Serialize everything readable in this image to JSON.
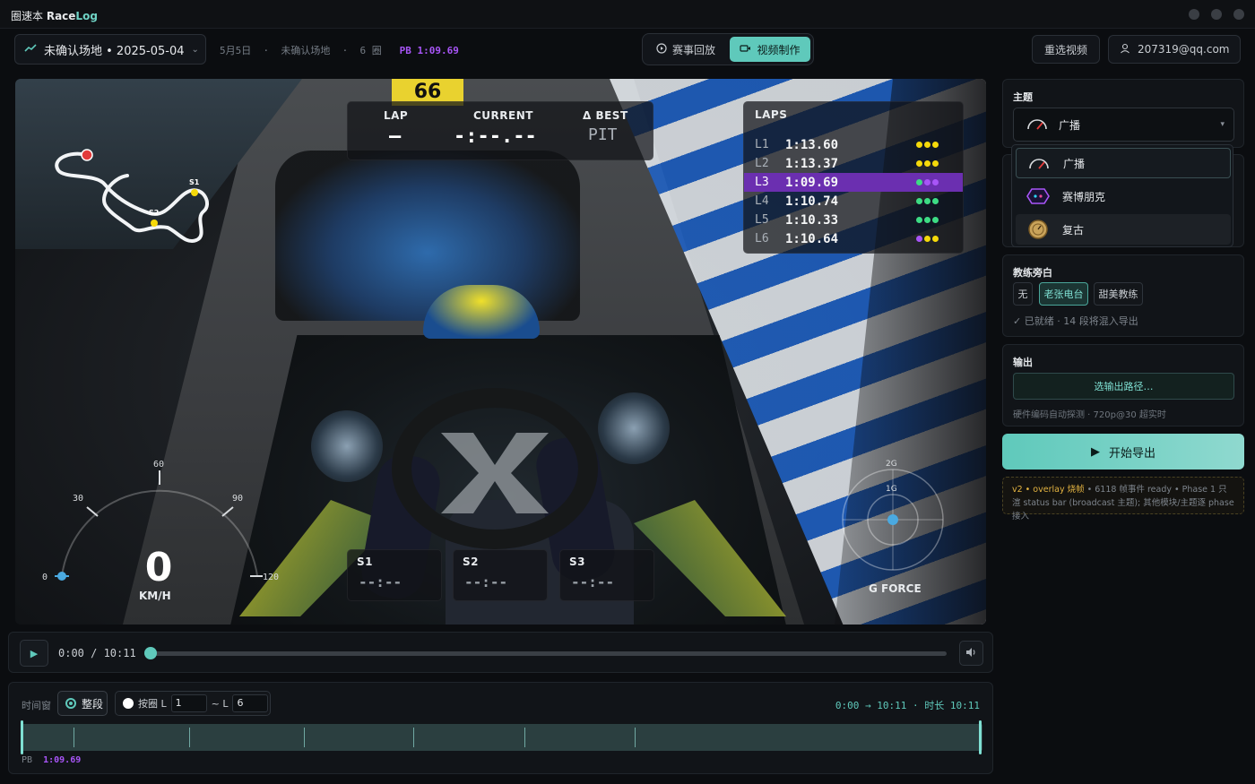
{
  "app": {
    "title_prefix": "圈速本 ",
    "title_brand": "Race",
    "title_brand_accent": "Log"
  },
  "topbar": {
    "session_label": "未确认场地 • 2025-05-04",
    "meta_date": "5月5日",
    "meta_sep": "·",
    "meta_track": "未确认场地",
    "meta_laps": "6 圈",
    "meta_pb_label": "PB",
    "meta_pb_value": "1:09.69",
    "mode_replay": "赛事回放",
    "mode_video": "视频制作",
    "reselect": "重选视频",
    "account": "207319@qq.com"
  },
  "video": {
    "kart_number": "66",
    "lap_label": "LAP",
    "lap_value": "—",
    "current_label": "CURRENT",
    "current_value": "-:--.--",
    "best_label": "Δ BEST",
    "best_value": "PIT",
    "laps_title": "LAPS",
    "laps": [
      {
        "n": "L1",
        "t": "1:13.60",
        "best": false,
        "dots": [
          "#f5d90a",
          "#f5d90a",
          "#f5d90a"
        ]
      },
      {
        "n": "L2",
        "t": "1:13.37",
        "best": false,
        "dots": [
          "#f5d90a",
          "#f5d90a",
          "#f5d90a"
        ]
      },
      {
        "n": "L3",
        "t": "1:09.69",
        "best": true,
        "dots": [
          "#3ddc84",
          "#a855f7",
          "#a855f7"
        ]
      },
      {
        "n": "L4",
        "t": "1:10.74",
        "best": false,
        "dots": [
          "#3ddc84",
          "#3ddc84",
          "#3ddc84"
        ]
      },
      {
        "n": "L5",
        "t": "1:10.33",
        "best": false,
        "dots": [
          "#3ddc84",
          "#3ddc84",
          "#3ddc84"
        ]
      },
      {
        "n": "L6",
        "t": "1:10.64",
        "best": false,
        "dots": [
          "#a855f7",
          "#f5d90a",
          "#f5d90a"
        ]
      }
    ],
    "map_s1": "S1",
    "map_s2": "S2",
    "sectors": [
      {
        "label": "S1",
        "value": "--:--"
      },
      {
        "label": "S2",
        "value": "--:--"
      },
      {
        "label": "S3",
        "value": "--:--"
      }
    ],
    "speed_value": "0",
    "speed_unit": "KM/H",
    "speed_ticks": [
      "0",
      "30",
      "60",
      "90",
      "120"
    ],
    "gforce_label": "G FORCE",
    "gforce_ticks": [
      "2G",
      "1G"
    ]
  },
  "playback": {
    "time": "0:00 / 10:11",
    "progress": 0.0
  },
  "timewindow": {
    "label": "时间窗",
    "whole": "整段",
    "bylap_prefix": "按圈 L",
    "lap_from": "1",
    "lap_sep": "~ L",
    "lap_to": "6",
    "range": "0:00 → 10:11 · 时长 10:11",
    "pb_label": "PB",
    "pb_value": "1:09.69"
  },
  "theme": {
    "title": "主题",
    "selected": "广播",
    "options": [
      "广播",
      "赛博朋克",
      "复古"
    ]
  },
  "coach": {
    "title": "教练旁白",
    "options": [
      "无",
      "老张电台",
      "甜美教练"
    ],
    "active": "老张电台",
    "status": "✓ 已就绪 · 14 段将混入导出"
  },
  "output": {
    "title": "输出",
    "choose_path": "选输出路径…",
    "hint": "硬件编码自动探测 · 720p@30 超实时"
  },
  "export": {
    "label": "开始导出"
  },
  "note": {
    "v2": "v2 • overlay 烧帧",
    "rest": " • 6118 帧事件 ready • Phase 1 只渲 status bar (broadcast 主题); 其他模块/主题逐 phase 接入"
  },
  "colors": {
    "accent": "#5fc9bb",
    "pb_purple": "#a855f7",
    "warn": "#e3b341"
  }
}
